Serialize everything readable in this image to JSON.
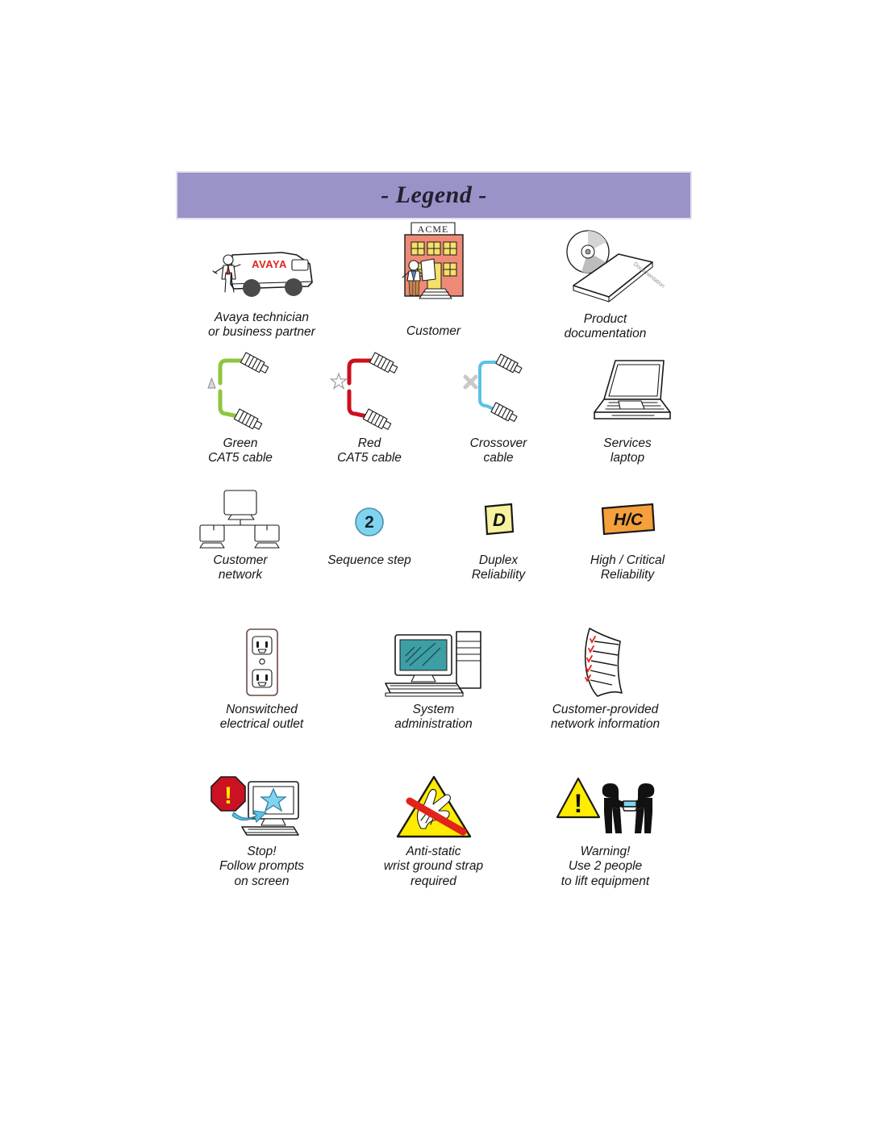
{
  "page": {
    "banner_title": "- Legend -",
    "background": "#ffffff"
  },
  "colors": {
    "banner": "#9a93c8",
    "banner_border": "#e3e1ef",
    "green_cable": "#8cc63f",
    "red_cable": "#cc0f1f",
    "crossover_cable": "#5bc2e7",
    "sequence_circle": "#7fd4f0",
    "duplex_tag": "#f7f2a0",
    "critical_tag": "#f5a03c",
    "warning_yellow": "#ffec00",
    "stop_red": "#cc1122",
    "monitor_teal": "#3d9fa5",
    "building_salmon": "#ef8a78",
    "window_yellow": "#f5e06a",
    "avaya_red": "#e2231a",
    "check_red": "#e2231a"
  },
  "legend": {
    "rows": [
      {
        "items": [
          {
            "icon": "avaya-van-technician-icon",
            "label": "Avaya technician\nor business partner"
          },
          {
            "icon": "acme-customer-building-icon",
            "label": "Customer",
            "building_sign": "ACME"
          },
          {
            "icon": "product-documentation-icon",
            "label": "Product\ndocumentation",
            "book_text": "Documentation"
          }
        ]
      },
      {
        "items": [
          {
            "icon": "green-cat5-cable-icon",
            "label": "Green\nCAT5 cable",
            "marker": "triangle"
          },
          {
            "icon": "red-cat5-cable-icon",
            "label": "Red\nCAT5 cable",
            "marker": "star"
          },
          {
            "icon": "crossover-cable-icon",
            "label": "Crossover\ncable",
            "marker": "cross"
          },
          {
            "icon": "services-laptop-icon",
            "label": "Services\nlaptop"
          }
        ]
      },
      {
        "items": [
          {
            "icon": "customer-network-icon",
            "label": "Customer\nnetwork"
          },
          {
            "icon": "sequence-step-icon",
            "label": "Sequence step",
            "badge_text": "2"
          },
          {
            "icon": "duplex-reliability-icon",
            "label": "Duplex\nReliability",
            "badge_text": "D"
          },
          {
            "icon": "high-critical-reliability-icon",
            "label": "High / Critical\nReliability",
            "badge_text": "H/C"
          }
        ]
      },
      {
        "items": [
          {
            "icon": "electrical-outlet-icon",
            "label": "Nonswitched\nelectrical outlet"
          },
          {
            "icon": "system-administration-icon",
            "label": "System\nadministration"
          },
          {
            "icon": "network-information-checklist-icon",
            "label": "Customer-provided\nnetwork information"
          }
        ]
      },
      {
        "items": [
          {
            "icon": "stop-follow-prompts-icon",
            "label": "Stop!\nFollow prompts\non screen"
          },
          {
            "icon": "anti-static-warning-icon",
            "label": "Anti-static\nwrist ground strap\nrequired"
          },
          {
            "icon": "two-person-lift-warning-icon",
            "label": "Warning!\nUse 2 people\nto lift equipment"
          }
        ]
      }
    ]
  }
}
